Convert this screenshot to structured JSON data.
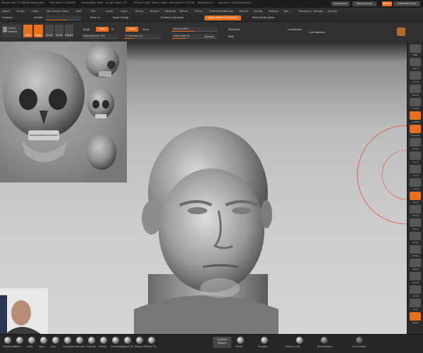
{
  "titlebar": {
    "items": [
      "ZBrush 4R7 P3",
      "ZBrush Document",
      "Free Mem 11.087GB",
      "Active Mem 3654",
      "Scratch Disk 137",
      "ZTime 1.848",
      "Timer 0.984",
      "PolyCount 1.172 MP",
      "MeshCount 1",
      "Volume 1.145 (AutoSave)"
    ],
    "right_buttons": [
      "QuickSave",
      "See-through",
      "Menus",
      "DefaultZScript"
    ]
  },
  "menubar": {
    "items": [
      "Alpha",
      "Brush",
      "Color",
      "Document",
      "Draw",
      "Edit",
      "File",
      "Layer",
      "Light",
      "Macro",
      "Marker",
      "Material",
      "Movie",
      "Picker",
      "Preferences",
      "Render",
      "Stencil",
      "Stroke",
      "Texture",
      "Tool",
      "Transform",
      "Zplugin",
      "Zscript"
    ]
  },
  "row3": {
    "left_label": "Connect",
    "infinite_label": "Infinite",
    "save_ui": "Save UI",
    "store_config": "Store Config",
    "enable_customize": "Enable Customize",
    "align_center": "Align Center To Surface",
    "reset_brushes": "Reset All Brushes"
  },
  "toolbar": {
    "quick_sketch": "Quick Sketch",
    "edit": "Edit",
    "draw": "Draw",
    "move": "Move",
    "scale": "Scale",
    "rotate": "Rotate",
    "mrgb": "Mrgb",
    "rgb": "Rgb",
    "m": "M",
    "rgb_intensity": "Rgb Intensity 100",
    "zadd": "Zadd",
    "zsub": "Zsub",
    "z_intensity": "Z Intensity 25",
    "focal_shift": "Focal Shift 0",
    "draw_size": "Draw Size 64",
    "dynamic": "Dynamic",
    "active_points": "ActivePoints: 1.172 Mil",
    "total_points": "TotalPoints: 1.172 Mil",
    "polypaint": "PolyPaint",
    "rest": "Rest",
    "lazy_mouse": "LazyMouse",
    "live_boolean": "Live Boolean"
  },
  "reference_panel": {
    "caption": "anatomy reference"
  },
  "bottom_brushes": [
    "ClayBuildup",
    "Pinch",
    "Inflat",
    "Move",
    "Clay",
    "ClayTubes",
    "Standard",
    "Magnify",
    "hPolish",
    "SnakeHook",
    "Alpha Off",
    "Texture Off",
    "Move Tp"
  ],
  "bottom_right": {
    "subtool_master": "SubTool Master",
    "brush_a": "Stroke",
    "brush_b": "DragDot",
    "material": "MatCap Gray",
    "basic_material": "BasicMaterial",
    "skin_shade": "SkinShade4"
  },
  "right_shelf": [
    "BPR",
    "SPix 3",
    "Scroll",
    "Zoom",
    "Actual",
    "AAHalf",
    "Dynamic",
    "Persp",
    "Floor",
    "Local",
    "L.Sym",
    "Gxyz",
    "Frame",
    "Move",
    "Scale",
    "Rotate",
    "PolyF",
    "Transp",
    "Ghost",
    "Solo",
    "Xpose"
  ],
  "colors": {
    "accent": "#e86f1e",
    "brush_ring": "#e84a3c"
  }
}
